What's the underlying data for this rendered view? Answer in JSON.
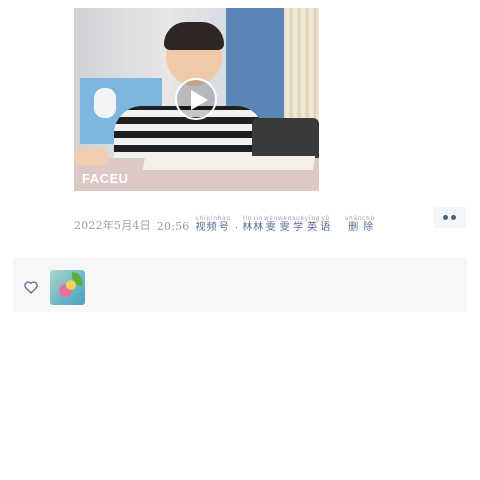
{
  "post": {
    "video_watermark": "FACEU",
    "meta": {
      "date": "2022年5月4日",
      "time": "20:56",
      "source_chars": [
        {
          "hanzi": "视",
          "pinyin": "shì"
        },
        {
          "hanzi": "频",
          "pinyin": "pín"
        },
        {
          "hanzi": "号",
          "pinyin": "hào"
        }
      ],
      "separator": "·",
      "account_chars": [
        {
          "hanzi": "林",
          "pinyin": "lín"
        },
        {
          "hanzi": "林",
          "pinyin": "lín"
        },
        {
          "hanzi": "雯",
          "pinyin": "wén"
        },
        {
          "hanzi": "雯",
          "pinyin": "wén"
        },
        {
          "hanzi": "学",
          "pinyin": "xué"
        },
        {
          "hanzi": "英",
          "pinyin": "yīng"
        },
        {
          "hanzi": "语",
          "pinyin": "yǔ"
        }
      ],
      "delete_chars": [
        {
          "hanzi": "删",
          "pinyin": "shān"
        },
        {
          "hanzi": "除",
          "pinyin": "chú"
        }
      ]
    }
  },
  "icons": {
    "play": "play-icon",
    "more": "more-dots-icon",
    "like": "heart-outline-icon"
  },
  "colors": {
    "link": "#576b95",
    "meta_gray": "#9aa0a6",
    "panel_bg": "#f7f7f7"
  }
}
